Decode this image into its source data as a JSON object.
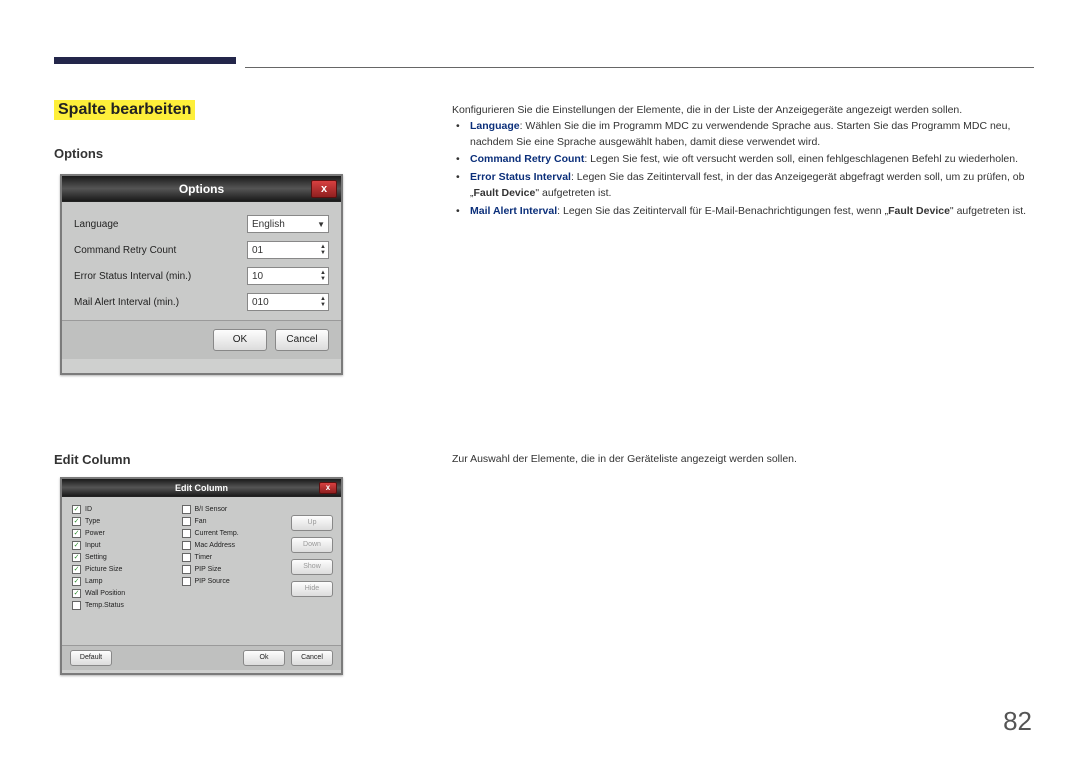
{
  "section_title": "Spalte bearbeiten",
  "options": {
    "heading": "Options",
    "intro": "Konfigurieren Sie die Einstellungen der Elemente, die in der Liste der Anzeigegeräte angezeigt werden sollen.",
    "bullets": [
      {
        "term": "Language",
        "text": ": Wählen Sie die im Programm MDC zu verwendende Sprache aus. Starten Sie das Programm MDC neu, nachdem Sie eine Sprache ausgewählt haben, damit diese verwendet wird."
      },
      {
        "term": "Command Retry Count",
        "text": ": Legen Sie fest, wie oft versucht werden soll, einen fehlgeschlagenen Befehl zu wiederholen."
      },
      {
        "term": "Error Status Interval",
        "text": ": Legen Sie das Zeitintervall fest, in der das Anzeigegerät abgefragt werden soll, um zu prüfen, ob „",
        "term2": "Fault Device",
        "text2": "\" aufgetreten ist."
      },
      {
        "term": "Mail Alert Interval",
        "text": ": Legen Sie das Zeitintervall für E-Mail-Benachrichtigungen fest, wenn „",
        "term2": "Fault Device",
        "text2": "\" aufgetreten ist."
      }
    ],
    "dialog": {
      "title": "Options",
      "close": "x",
      "rows": [
        {
          "label": "Language",
          "value": "English",
          "type": "dropdown"
        },
        {
          "label": "Command Retry Count",
          "value": "01",
          "type": "spinner"
        },
        {
          "label": "Error Status Interval (min.)",
          "value": "10",
          "type": "spinner"
        },
        {
          "label": "Mail Alert Interval (min.)",
          "value": "010",
          "type": "spinner"
        }
      ],
      "ok": "OK",
      "cancel": "Cancel"
    }
  },
  "editcolumn": {
    "heading": "Edit Column",
    "intro": "Zur Auswahl der Elemente, die in der Geräteliste angezeigt werden sollen.",
    "dialog": {
      "title": "Edit Column",
      "close": "x",
      "col1": [
        {
          "label": "ID",
          "checked": true
        },
        {
          "label": "Type",
          "checked": true
        },
        {
          "label": "Power",
          "checked": true
        },
        {
          "label": "Input",
          "checked": true
        },
        {
          "label": "Setting",
          "checked": true
        },
        {
          "label": "Picture Size",
          "checked": true
        },
        {
          "label": "Lamp",
          "checked": true
        },
        {
          "label": "Wall Position",
          "checked": true
        },
        {
          "label": "Temp.Status",
          "checked": false
        }
      ],
      "col2": [
        {
          "label": "B/I Sensor",
          "checked": false
        },
        {
          "label": "Fan",
          "checked": false
        },
        {
          "label": "Current Temp.",
          "checked": false
        },
        {
          "label": "Mac Address",
          "checked": false
        },
        {
          "label": "Timer",
          "checked": false
        },
        {
          "label": "PIP Size",
          "checked": false
        },
        {
          "label": "PIP Source",
          "checked": false
        }
      ],
      "move_buttons": [
        "Up",
        "Down",
        "Show",
        "Hide"
      ],
      "default": "Default",
      "ok": "Ok",
      "cancel": "Cancel"
    }
  },
  "page_number": "82"
}
